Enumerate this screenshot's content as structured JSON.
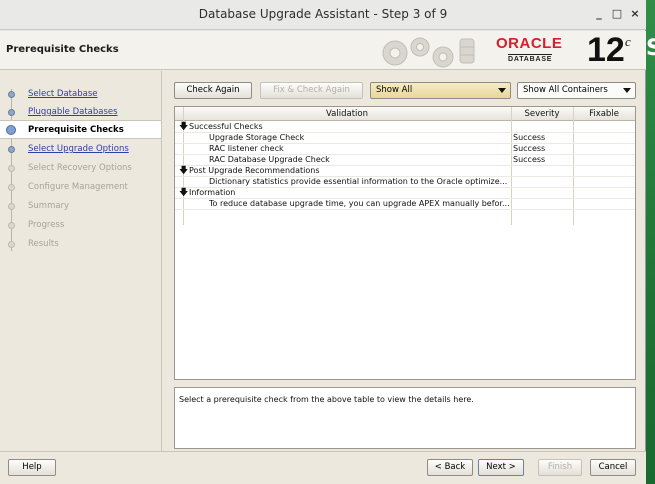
{
  "window": {
    "title": "Database Upgrade Assistant - Step 3 of 9"
  },
  "window_controls": {
    "minimize": "_",
    "maximize": "□",
    "close": "×"
  },
  "header": {
    "page_title": "Prerequisite Checks",
    "logo_text": "ORACLE",
    "logo_sub": "DATABASE",
    "version": "12",
    "version_suffix": "c"
  },
  "desktop_fragment": "S",
  "nav": {
    "items": [
      {
        "label": "Select Database",
        "state": "done"
      },
      {
        "label": "Pluggable Databases",
        "state": "done"
      },
      {
        "label": "Prerequisite Checks",
        "state": "current"
      },
      {
        "label": "Select Upgrade Options",
        "state": "done"
      },
      {
        "label": "Select Recovery Options",
        "state": "pending"
      },
      {
        "label": "Configure Management",
        "state": "pending"
      },
      {
        "label": "Summary",
        "state": "pending"
      },
      {
        "label": "Progress",
        "state": "pending"
      },
      {
        "label": "Results",
        "state": "pending"
      }
    ]
  },
  "toolbar": {
    "check_again": "Check Again",
    "fix_check_again": "Fix & Check Again",
    "filter_selected": "Show All",
    "containers_selected": "Show All Containers"
  },
  "table": {
    "columns": [
      "Validation",
      "Severity",
      "Fixable"
    ],
    "rows": [
      {
        "type": "group",
        "validation": "Successful Checks",
        "severity": "",
        "fixable": ""
      },
      {
        "type": "item",
        "validation": "Upgrade Storage Check",
        "severity": "Success",
        "fixable": ""
      },
      {
        "type": "item",
        "validation": "RAC listener check",
        "severity": "Success",
        "fixable": ""
      },
      {
        "type": "item",
        "validation": "RAC Database Upgrade Check",
        "severity": "Success",
        "fixable": ""
      },
      {
        "type": "group",
        "validation": "Post Upgrade Recommendations",
        "severity": "",
        "fixable": ""
      },
      {
        "type": "item",
        "validation": "Dictionary statistics provide essential information to the Oracle optimize...",
        "severity": "",
        "fixable": ""
      },
      {
        "type": "group",
        "validation": "Information",
        "severity": "",
        "fixable": ""
      },
      {
        "type": "item",
        "validation": "To reduce database upgrade time, you can upgrade APEX manually befor...",
        "severity": "",
        "fixable": ""
      }
    ]
  },
  "details": {
    "text": "Select a prerequisite check from the above table to view the details here."
  },
  "footer": {
    "help": "Help",
    "back": "< Back",
    "next": "Next >",
    "finish": "Finish",
    "cancel": "Cancel"
  }
}
